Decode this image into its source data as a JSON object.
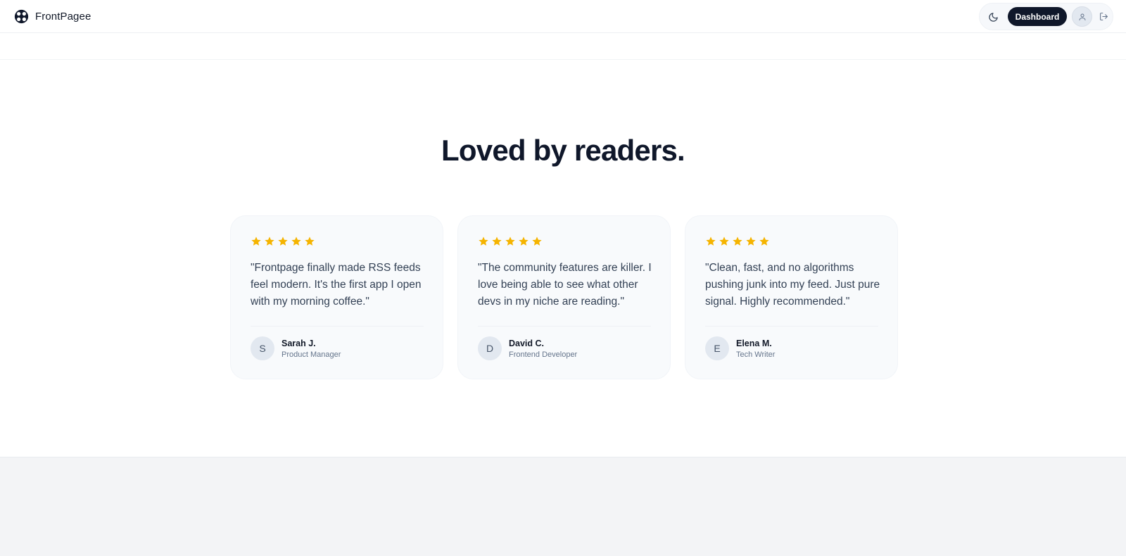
{
  "brand": {
    "name": "FrontPagee"
  },
  "nav": {
    "dashboard_label": "Dashboard"
  },
  "colors": {
    "star": "#f5b400",
    "primary": "#0f172a",
    "card_bg": "#f8fafc",
    "footer_bg": "#f3f4f6"
  },
  "section": {
    "title": "Loved by readers."
  },
  "testimonials": [
    {
      "rating": 5,
      "quote": "\"Frontpage finally made RSS feeds feel modern. It's the first app I open with my morning coffee.\"",
      "initial": "S",
      "name": "Sarah J.",
      "role": "Product Manager"
    },
    {
      "rating": 5,
      "quote": "\"The community features are killer. I love being able to see what other devs in my niche are reading.\"",
      "initial": "D",
      "name": "David C.",
      "role": "Frontend Developer"
    },
    {
      "rating": 5,
      "quote": "\"Clean, fast, and no algorithms pushing junk into my feed. Just pure signal. Highly recommended.\"",
      "initial": "E",
      "name": "Elena M.",
      "role": "Tech Writer"
    }
  ],
  "icons": {
    "logo": "frontpage-logo-icon",
    "theme": "moon-icon",
    "avatar": "user-icon",
    "logout": "logout-icon",
    "star": "star-icon"
  }
}
